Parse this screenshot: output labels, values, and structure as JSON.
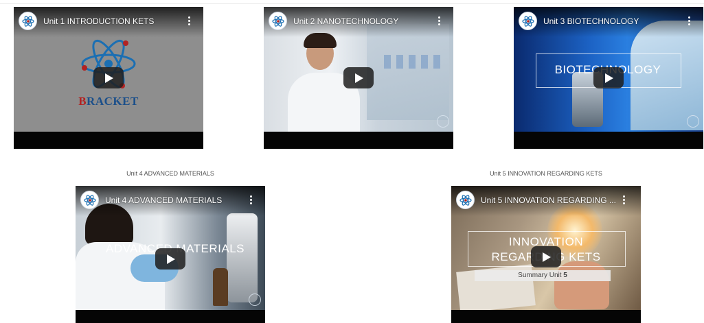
{
  "colors": {
    "brand_blue": "#1b6fb3",
    "brand_red": "#b22222",
    "player_black": "#000000"
  },
  "videos": [
    {
      "title": "Unit 1 INTRODUCTION KETS",
      "caption": "",
      "thumbnail_text": "BRACKET",
      "thumbnail_initial": "B",
      "thumbnail_rest": "RACKET"
    },
    {
      "title": "Unit 2 NANOTECHNOLOGY",
      "caption": ""
    },
    {
      "title": "Unit 3 BIOTECHNOLOGY",
      "caption": "",
      "overlay_text": "BIOTECHNOLOGY"
    },
    {
      "title": "Unit 4 ADVANCED MATERIALS",
      "caption": "Unit 4 ADVANCED MATERIALS",
      "overlay_text": "ADVANCED MATERIALS"
    },
    {
      "title": "Unit 5 INNOVATION REGARDING ...",
      "caption": "Unit 5 INNOVATION REGARDING KETS",
      "overlay_line1": "INNOVATION",
      "overlay_line2": "REGARDING KETS",
      "overlay_sub_prefix": "Summary Unit ",
      "overlay_sub_num": "5"
    }
  ],
  "icons": {
    "channel": "atom-logo-icon",
    "play": "play-icon",
    "menu": "more-vertical-icon"
  }
}
